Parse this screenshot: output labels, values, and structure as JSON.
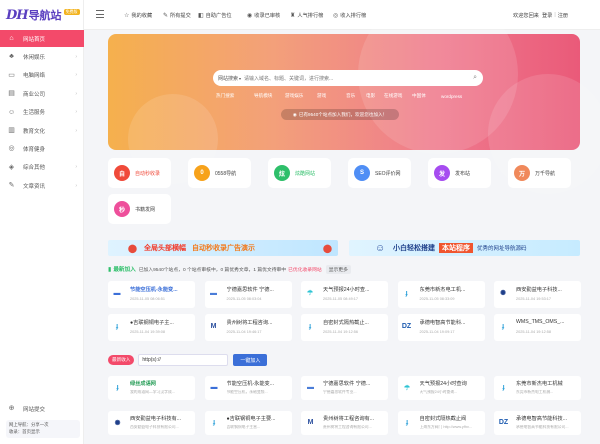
{
  "logo": {
    "dh": "DH",
    "name": "导航站",
    "badge": "免费版"
  },
  "sidebar": {
    "items": [
      {
        "label": "网站首页",
        "icon": "home-icon",
        "glyph": "⌂",
        "active": true,
        "arrow": false
      },
      {
        "label": "休闲娱乐",
        "icon": "game-icon",
        "glyph": "♣",
        "active": false,
        "arrow": true
      },
      {
        "label": "电脑网络",
        "icon": "computer-icon",
        "glyph": "▭",
        "active": false,
        "arrow": true
      },
      {
        "label": "商业公司",
        "icon": "building-icon",
        "glyph": "▤",
        "active": false,
        "arrow": true
      },
      {
        "label": "生活服务",
        "icon": "life-icon",
        "glyph": "☺",
        "active": false,
        "arrow": true
      },
      {
        "label": "教育文化",
        "icon": "book-icon",
        "glyph": "▥",
        "active": false,
        "arrow": true
      },
      {
        "label": "体育健身",
        "icon": "sport-icon",
        "glyph": "◎",
        "active": false,
        "arrow": false
      },
      {
        "label": "综合其他",
        "icon": "other-icon",
        "glyph": "◈",
        "active": false,
        "arrow": true
      },
      {
        "label": "文章资讯",
        "icon": "article-icon",
        "glyph": "✎",
        "active": false,
        "arrow": true
      }
    ],
    "submit_label": "网站提交",
    "footer_line1": "网上导航：分享一次",
    "footer_line2": "收录：首页显示"
  },
  "topbar": {
    "items": [
      "我的收藏",
      "所有提交",
      "自助广告位",
      "收录已审核",
      "人气排行榜",
      "收入排行榜"
    ],
    "welcome": "欢迎您回来",
    "login": "登录",
    "register": "注册"
  },
  "hero": {
    "search_category": "网站搜索",
    "search_placeholder": "请输入域名、标题、关键词，进行搜索...",
    "hot_keywords": [
      "热门搜索",
      "导航模块",
      "游戏娱乐",
      "游戏",
      "音乐",
      "电影",
      "在线游戏",
      "中国体",
      "wordpress"
    ],
    "notice": "已有9540个站点加入我们，欢迎您也加入！"
  },
  "quick_cards": [
    {
      "label": "自动秒收录",
      "glyph": "自",
      "color": "#f04a3a",
      "active": true
    },
    {
      "label": "0558导航",
      "glyph": "0",
      "color": "#f7a21b",
      "active": false
    },
    {
      "label": "炫酷网站",
      "glyph": "炫",
      "color": "#2ebf6a",
      "active": true
    },
    {
      "label": "SEO评价网",
      "glyph": "S",
      "color": "#4f8ef5",
      "active": false
    },
    {
      "label": "发布站",
      "glyph": "发",
      "color": "#a64cf0",
      "active": false
    },
    {
      "label": "万千导航",
      "glyph": "万",
      "color": "#f0895b",
      "active": false
    },
    {
      "label": "书籍发网",
      "glyph": "秒",
      "color": "#ee4f9b",
      "active": false
    }
  ],
  "banners": {
    "left_a": "全局头部横幅",
    "left_b": "自动秒收录广告演示",
    "right_a": "小白轻松搭建",
    "right_b": "本站程序",
    "right_c": "优秀的网址导航源码"
  },
  "stats": {
    "title": "最新加入",
    "text": "已加入9540个站点，0 个站点审核中，0 篇优秀文章，1 篇优文待审中",
    "highlight": "已优化收录网站",
    "tag": "显示更多"
  },
  "latest_sites": [
    {
      "name": "节能空压机-永能变...",
      "date": "2025-11-05 08:06:51",
      "logo": "▬",
      "logo_color": "#3b6fd8",
      "highlight": true
    },
    {
      "name": "宁德嘉思软件 宁德...",
      "date": "2025-11-05 08:03:04",
      "logo": "▬",
      "logo_color": "#4b7dd8",
      "highlight": false
    },
    {
      "name": "天气预报24小时查...",
      "date": "2025-11-05 08:49:17",
      "logo": "☂",
      "logo_color": "#2ec4d4",
      "highlight": false
    },
    {
      "name": "东莞市新杰电工机...",
      "date": "2025-11-05 08:33:09",
      "logo": "ɟ",
      "logo_color": "#2a9fd8",
      "highlight": false
    },
    {
      "name": "西安勤益电子科技...",
      "date": "2025-11-04 19:53:17",
      "logo": "✺",
      "logo_color": "#1f3f8a",
      "highlight": false
    },
    {
      "name": "●吉联钢铜电子主...",
      "date": "2025-11-04 19:39:08",
      "logo": "ɟ",
      "logo_color": "#2a9fd8",
      "highlight": false
    },
    {
      "name": "贵州树将工程咨询...",
      "date": "2025-11-04 19:46:17",
      "logo": "M",
      "logo_color": "#2b4f9e",
      "highlight": false
    },
    {
      "name": "自密封式隔热截止...",
      "date": "2025-11-04 19:12:56",
      "logo": "ɟ",
      "logo_color": "#2a9fd8",
      "highlight": false
    },
    {
      "name": "承德电智高节能科...",
      "date": "2025-11-04 19:09:17",
      "logo": "DZ",
      "logo_color": "#1d5bb0",
      "highlight": false
    },
    {
      "name": "WMS_TMS_OMS_...",
      "date": "2025-11-04 19:12:58",
      "logo": "ɟ",
      "logo_color": "#2a9fd8",
      "highlight": false
    }
  ],
  "url_input": {
    "tag": "最新收入",
    "value": "http(s)://",
    "button": "一键加入"
  },
  "more_sites": [
    {
      "name": "绿丝成语网",
      "desc": "我的成语网—学习汉字成...",
      "logo": "ɟ",
      "logo_color": "#2a9fd8",
      "highlight": true
    },
    {
      "name": "节能空压机-永能变...",
      "desc": "节能空压机，永磁变频...",
      "logo": "▬",
      "logo_color": "#3b6fd8",
      "highlight": false
    },
    {
      "name": "宁德嘉思软件 宁德...",
      "desc": "宁德嘉思软件专业...",
      "logo": "▬",
      "logo_color": "#4b7dd8",
      "highlight": false
    },
    {
      "name": "天气预报24小时查询",
      "desc": "天气预报24小时查询...",
      "logo": "☂",
      "logo_color": "#2ec4d4",
      "highlight": false
    },
    {
      "name": "东莞市新杰电工机械",
      "desc": "东莞市新杰电工机械...",
      "logo": "ɟ",
      "logo_color": "#2a9fd8",
      "highlight": false
    },
    {
      "name": "西安勤益电子科技有...",
      "desc": "西安勤益电子科技有限公司...",
      "logo": "✺",
      "logo_color": "#1f3f8a",
      "highlight": false
    },
    {
      "name": "●吉联钢铜电子主要...",
      "desc": "吉联钢铜电子主营...",
      "logo": "ɟ",
      "logo_color": "#2a9fd8",
      "highlight": false
    },
    {
      "name": "贵州树将工程咨询有...",
      "desc": "贵州树将工程咨询有限公司...",
      "logo": "M",
      "logo_color": "#2b4f9e",
      "highlight": false
    },
    {
      "name": "自密封式隔热截止阀",
      "desc": "上海东方阀门 http://www.yfhv...",
      "logo": "ɟ",
      "logo_color": "#2a9fd8",
      "highlight": false
    },
    {
      "name": "承德电智高节能科技...",
      "desc": "承德电智高节能科技有限公司...",
      "logo": "DZ",
      "logo_color": "#1d5bb0",
      "highlight": false
    }
  ]
}
